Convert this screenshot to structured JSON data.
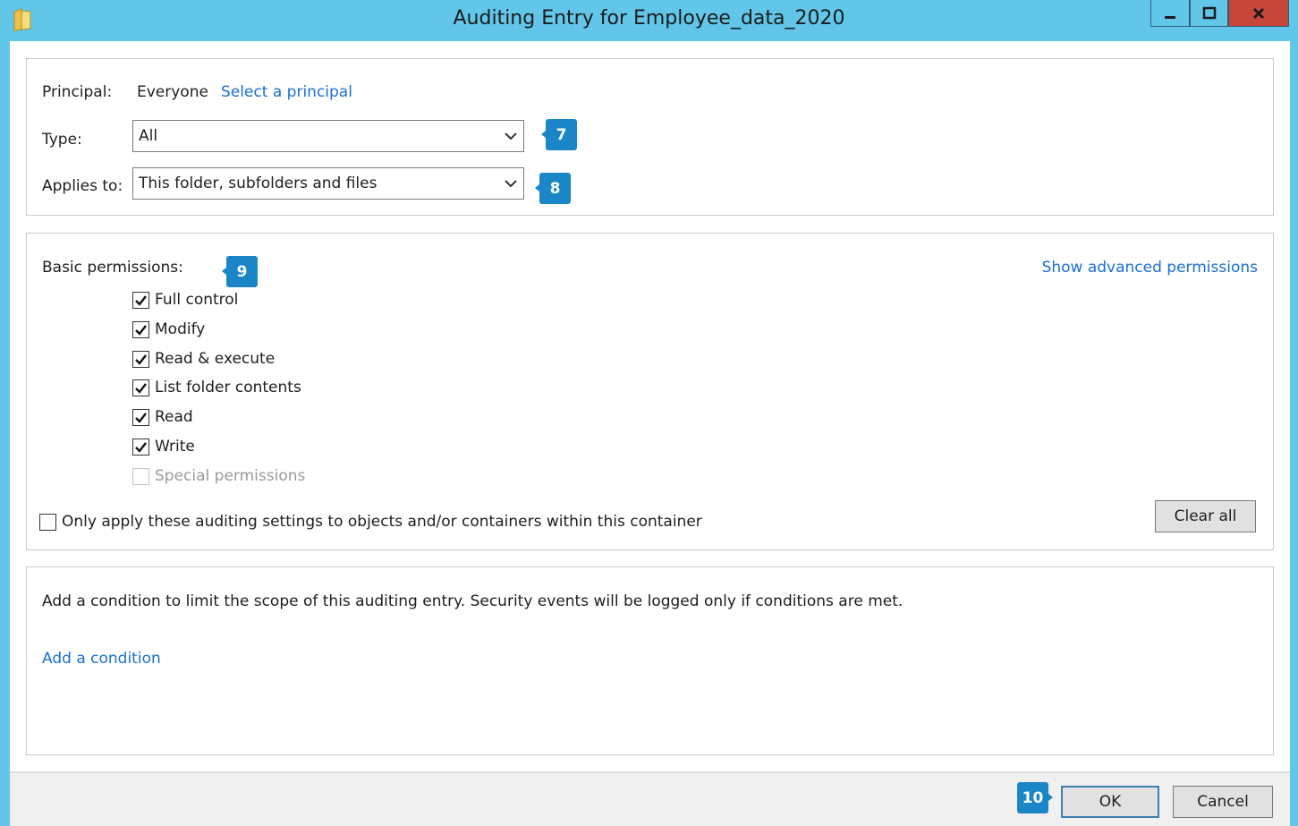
{
  "window": {
    "title": "Auditing Entry for Employee_data_2020",
    "icon": "folder-icon",
    "controls": {
      "minimize": "minimize-icon",
      "maximize": "maximize-icon",
      "close": "close-icon"
    }
  },
  "principal": {
    "label": "Principal:",
    "value": "Everyone",
    "select_link": "Select a principal"
  },
  "type": {
    "label": "Type:",
    "value": "All"
  },
  "applies_to": {
    "label": "Applies to:",
    "value": "This folder, subfolders and files"
  },
  "callouts": {
    "type": "7",
    "applies_to": "8",
    "permissions": "9",
    "ok": "10"
  },
  "permissions": {
    "label": "Basic permissions:",
    "show_advanced": "Show advanced permissions",
    "items": [
      {
        "label": "Full control",
        "checked": true,
        "enabled": true
      },
      {
        "label": "Modify",
        "checked": true,
        "enabled": true
      },
      {
        "label": "Read & execute",
        "checked": true,
        "enabled": true
      },
      {
        "label": "List folder contents",
        "checked": true,
        "enabled": true
      },
      {
        "label": "Read",
        "checked": true,
        "enabled": true
      },
      {
        "label": "Write",
        "checked": true,
        "enabled": true
      },
      {
        "label": "Special permissions",
        "checked": false,
        "enabled": false
      }
    ],
    "only_apply": {
      "label": "Only apply these auditing settings to objects and/or containers within this container",
      "checked": false
    },
    "clear_all": "Clear all"
  },
  "condition": {
    "description": "Add a condition to limit the scope of this auditing entry. Security events will be logged only if conditions are met.",
    "add_link": "Add a condition"
  },
  "buttons": {
    "ok": "OK",
    "cancel": "Cancel"
  },
  "colors": {
    "titlebar": "#62c6e8",
    "close": "#c7463c",
    "link": "#1a6fd1",
    "badge": "#1a86c8"
  }
}
